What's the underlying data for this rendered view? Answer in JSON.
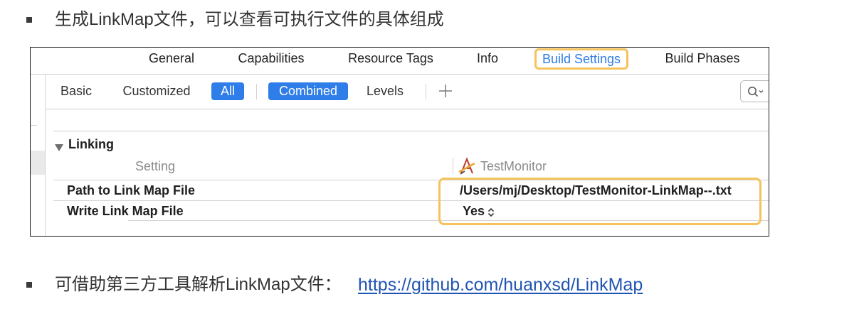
{
  "bullets": [
    {
      "text": "生成LinkMap文件，可以查看可执行文件的具体组成"
    },
    {
      "text": "可借助第三方工具解析LinkMap文件：",
      "link": "https://github.com/huanxsd/LinkMap"
    }
  ],
  "xcode": {
    "tabs": [
      {
        "label": "General"
      },
      {
        "label": "Capabilities"
      },
      {
        "label": "Resource Tags"
      },
      {
        "label": "Info"
      },
      {
        "label": "Build Settings",
        "active": true,
        "highlighted": true
      },
      {
        "label": "Build Phases"
      }
    ],
    "filter_bar": {
      "items": [
        {
          "label": "Basic",
          "selected": false
        },
        {
          "label": "Customized",
          "selected": false
        },
        {
          "label": "All",
          "selected": true
        },
        {
          "label": "Combined",
          "selected": true
        },
        {
          "label": "Levels",
          "selected": false
        }
      ],
      "add_icon": "plus-icon",
      "search_icon": "search-icon",
      "search_menu_icon": "chevron-down-icon"
    },
    "section": {
      "title": "Linking",
      "expanded": true,
      "disclosure_icon": "disclosure-triangle-icon",
      "columns": {
        "setting": "Setting",
        "target": "TestMonitor",
        "target_icon": "app-target-icon"
      },
      "rows": [
        {
          "setting": "Path to Link Map File",
          "value": "/Users/mj/Desktop/TestMonitor-LinkMap--.txt"
        },
        {
          "setting": "Write Link Map File",
          "value": "Yes",
          "value_icon": "up-down-chevron-icon"
        }
      ],
      "values_highlighted": true
    }
  },
  "colors": {
    "text": "#333333",
    "accent": "#2f7de8",
    "highlight": "#f5c25b",
    "link": "#2155b3"
  }
}
